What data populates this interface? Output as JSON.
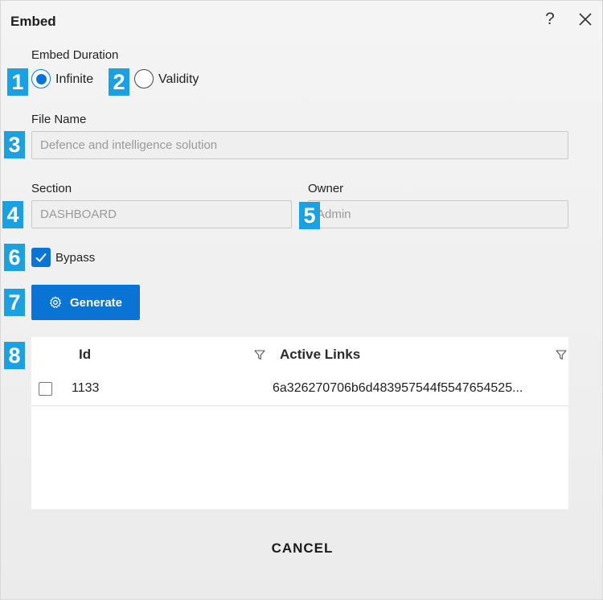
{
  "dialog": {
    "title": "Embed",
    "help_icon": "help-icon",
    "close_icon": "close-icon"
  },
  "embed_duration": {
    "label": "Embed Duration",
    "options": [
      {
        "label": "Infinite",
        "selected": true
      },
      {
        "label": "Validity",
        "selected": false
      }
    ]
  },
  "file_name": {
    "label": "File Name",
    "value": "Defence and intelligence solution"
  },
  "section": {
    "label": "Section",
    "value": "DASHBOARD"
  },
  "owner": {
    "label": "Owner",
    "value": "Admin"
  },
  "bypass": {
    "label": "Bypass",
    "checked": true
  },
  "generate_button": {
    "label": "Generate",
    "icon": "gear-icon"
  },
  "links_grid": {
    "columns": [
      "Id",
      "Active Links"
    ],
    "rows": [
      {
        "id": "1133",
        "link": "6a326270706b6d483957544f5547654525..."
      }
    ]
  },
  "badges": [
    "1",
    "2",
    "3",
    "4",
    "5",
    "6",
    "7",
    "8"
  ],
  "footer": {
    "cancel_label": "CANCEL"
  },
  "colors": {
    "accent": "#0a74d4",
    "badge": "#1ba1e2"
  }
}
